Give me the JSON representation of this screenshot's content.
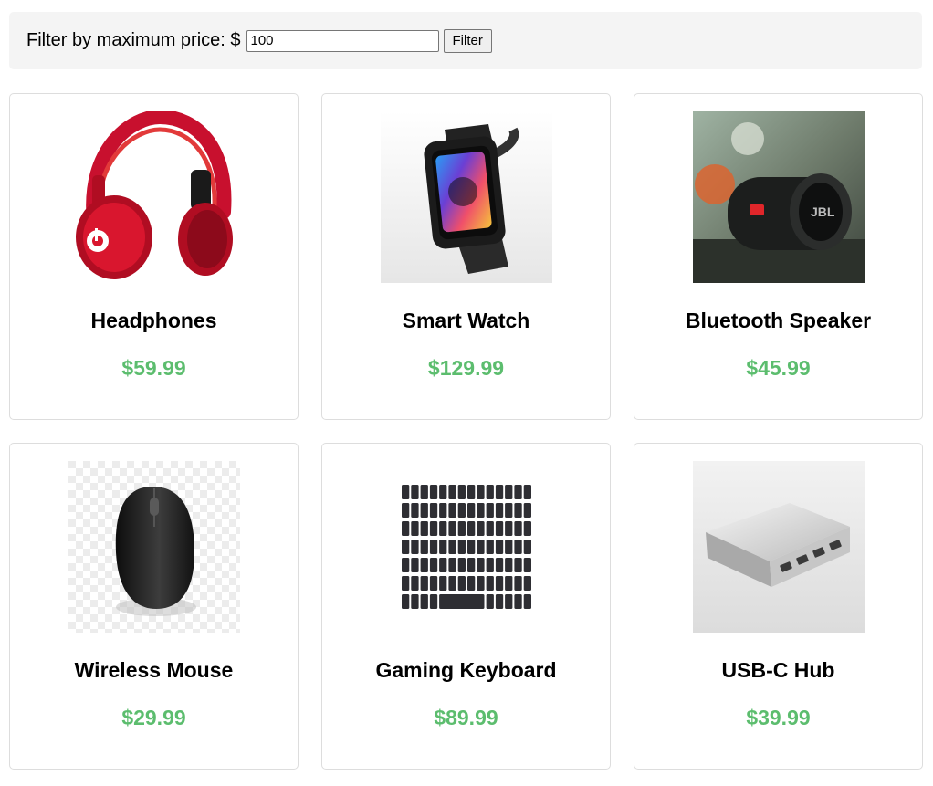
{
  "filter": {
    "label": "Filter by maximum price: $",
    "value": "100",
    "button_label": "Filter"
  },
  "products": [
    {
      "name": "Headphones",
      "price": "$59.99",
      "image": "headphones-image"
    },
    {
      "name": "Smart Watch",
      "price": "$129.99",
      "image": "smart-watch-image"
    },
    {
      "name": "Bluetooth Speaker",
      "price": "$45.99",
      "image": "bluetooth-speaker-image"
    },
    {
      "name": "Wireless Mouse",
      "price": "$29.99",
      "image": "wireless-mouse-image"
    },
    {
      "name": "Gaming Keyboard",
      "price": "$89.99",
      "image": "gaming-keyboard-image"
    },
    {
      "name": "USB-C Hub",
      "price": "$39.99",
      "image": "usb-c-hub-image"
    }
  ],
  "colors": {
    "price": "#5cbd6e",
    "filter_bar_bg": "#f4f4f4",
    "card_border": "#dddddd"
  },
  "logo_text": {
    "speaker_brand": "JBL"
  }
}
